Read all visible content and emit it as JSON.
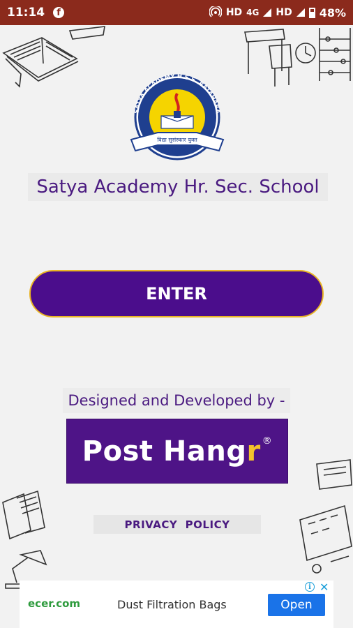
{
  "status_bar": {
    "time": "11:14",
    "network_hd1": "HD",
    "network_4g": "4G",
    "network_hd2": "HD",
    "battery_percent": "48%",
    "icons": [
      "facebook-icon",
      "hotspot-icon",
      "signal-icon",
      "battery-icon"
    ]
  },
  "logo": {
    "arc_text": "SATYA ACADEMY H.S.S. RATAHARA",
    "banner_text": "विद्या सुसंस्कार युक्त",
    "city": "REWA"
  },
  "school_name": "Satya Academy Hr. Sec. School",
  "enter_button": {
    "label": "ENTER"
  },
  "credits": {
    "designed_by": "Designed and Developed by -",
    "brand_main": "Post Hang",
    "brand_accent": "r",
    "brand_reg": "®"
  },
  "privacy_link": {
    "label": "PRIVACY  POLICY"
  },
  "ad": {
    "advertiser": "ecer.com",
    "title": "Dust Filtration Bags",
    "cta": "Open",
    "info_symbol": "i",
    "close_symbol": "✕"
  },
  "colors": {
    "status_bar": "#8b2a1c",
    "primary_purple": "#4b0d8c",
    "button_border": "#e9b423",
    "text_purple": "#4a1a80",
    "brand_accent": "#f4c32b",
    "ad_button": "#1a73e8"
  }
}
